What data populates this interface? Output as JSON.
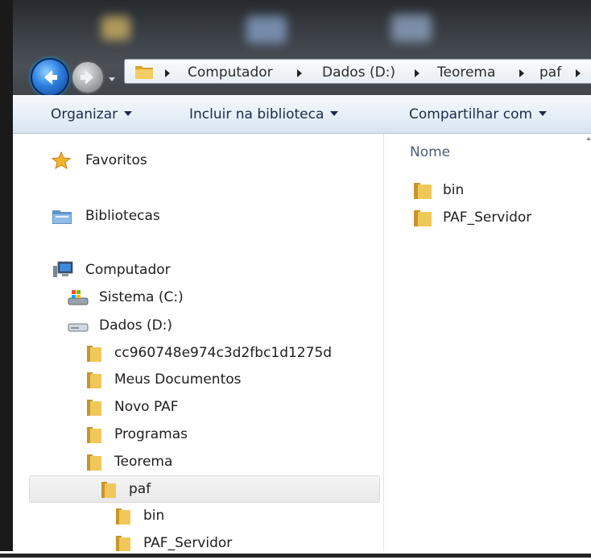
{
  "address_bar": {
    "crumbs": [
      "Computador",
      "Dados (D:)",
      "Teorema",
      "paf"
    ]
  },
  "toolbar": {
    "organize": "Organizar",
    "include_library": "Incluir na biblioteca",
    "share_with": "Compartilhar com"
  },
  "nav_pane": {
    "favorites": "Favoritos",
    "libraries": "Bibliotecas",
    "computer": "Computador",
    "drive_c": "Sistema (C:)",
    "drive_d": "Dados (D:)",
    "folders": [
      "cc960748e974c3d2fbc1d1275d",
      "Meus Documentos",
      "Novo PAF",
      "Programas",
      "Teorema",
      "paf",
      "bin",
      "PAF_Servidor"
    ]
  },
  "content": {
    "column_name": "Nome",
    "files": [
      "bin",
      "PAF_Servidor"
    ]
  },
  "colors": {
    "folder": "#e8b93b",
    "toolbar_text": "#1c2c47",
    "column_header": "#4c6079"
  },
  "icons": [
    "back-arrow-icon",
    "forward-arrow-icon",
    "star-icon",
    "library-icon",
    "computer-icon",
    "drive-c-icon",
    "drive-d-icon",
    "folder-icon"
  ]
}
